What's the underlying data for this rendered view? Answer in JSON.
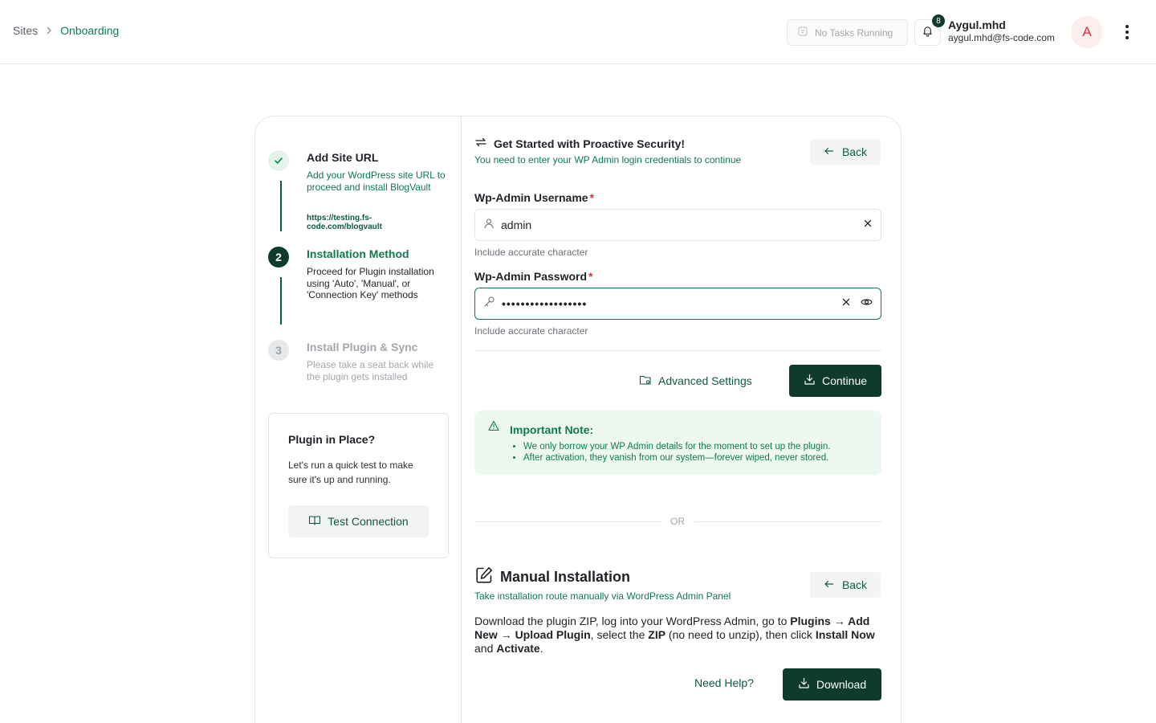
{
  "header": {
    "breadcrumb": {
      "root": "Sites",
      "current": "Onboarding"
    },
    "tasks_status": "No Tasks Running",
    "notifications_count": "8",
    "user": {
      "name": "Aygul.mhd",
      "email": "aygul.mhd@fs-code.com",
      "avatar_initial": "A"
    }
  },
  "steps": [
    {
      "number": "1",
      "state": "completed",
      "title": "Add Site URL",
      "description": "Add your WordPress site URL to proceed and install BlogVault",
      "url": "https://testing.fs-code.com/blogvault"
    },
    {
      "number": "2",
      "state": "active",
      "title": "Installation Method",
      "description": "Proceed for Plugin installation using 'Auto', 'Manual', or 'Connection Key' methods"
    },
    {
      "number": "3",
      "state": "pending",
      "title": "Install Plugin & Sync",
      "description": "Please take a seat back while the plugin gets installed"
    }
  ],
  "plugin_check": {
    "title": "Plugin in Place?",
    "description": "Let's run a quick test to make sure it's up and running.",
    "button_label": "Test Connection"
  },
  "auto_install": {
    "title": "Get Started with Proactive Security!",
    "subtitle": "You need to enter your WP Admin login credentials to continue",
    "back_label": "Back",
    "username": {
      "label": "Wp-Admin Username",
      "required_mark": "*",
      "value": "admin",
      "hint": "Include accurate character"
    },
    "password": {
      "label": "Wp-Admin Password",
      "required_mark": "*",
      "value": "••••••••••••••••••",
      "hint": "Include accurate character"
    },
    "advanced_label": "Advanced Settings",
    "continue_label": "Continue"
  },
  "note": {
    "title": "Important Note:",
    "items": [
      "We only borrow your WP Admin details for the moment to set up the plugin.",
      "After activation, they vanish from our system—forever wiped, never stored."
    ]
  },
  "separator_label": "OR",
  "manual_install": {
    "title": "Manual Installation",
    "subtitle": "Take installation route manually via WordPress Admin Panel",
    "back_label": "Back",
    "instructions": {
      "t1": "Download the plugin ZIP, log into your WordPress Admin, go to ",
      "b1": "Plugins → Add New → Upload Plugin",
      "t2": ", select the ",
      "b2": "ZIP",
      "t3": " (no need to unzip), then click ",
      "b3": "Install Now",
      "t4": " and ",
      "b4": "Activate",
      "t5": "."
    },
    "help_label": "Need Help?",
    "download_label": "Download"
  },
  "colors": {
    "brand_dark": "#0e3b2c",
    "brand_green": "#0f7a4f",
    "note_bg": "#edf8f1",
    "required": "#d1343b"
  }
}
